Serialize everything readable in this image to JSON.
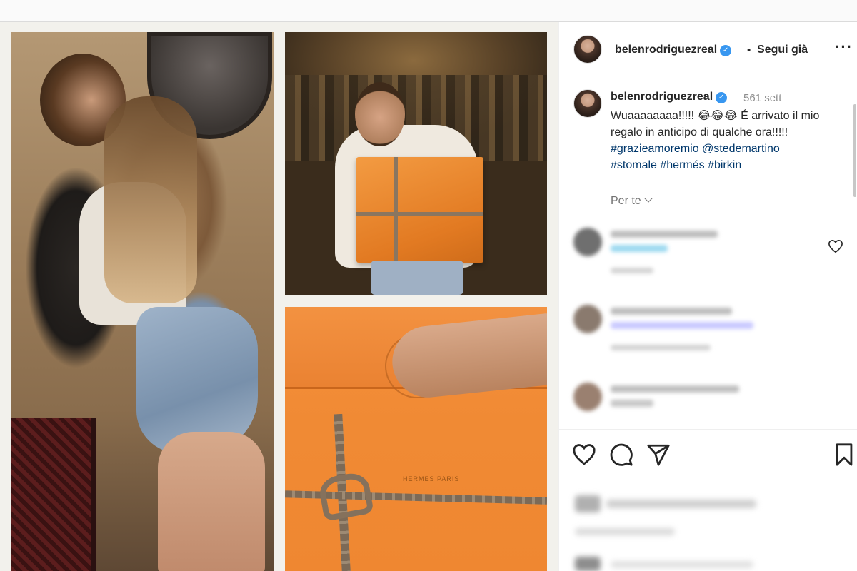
{
  "post": {
    "username": "belenrodriguezreal",
    "verified_mark": "✓",
    "dot": "•",
    "follow_label": "Segui già",
    "more_label": "···",
    "time_ago": "561 sett",
    "caption_text": "Wuaaaaaaaa!!!!! 😂😂😂 É arrivato il mio regalo in anticipo di qualche ora!!!!!",
    "hashtags": [
      "#grazieamoremio",
      "@stedemartino",
      "#stomale",
      "#hermés",
      "#birkin"
    ],
    "filter_label": "Per te",
    "box_brand": "HERMES PARIS"
  },
  "icons": {
    "like": "heart-icon",
    "comment": "comment-icon",
    "share": "share-icon",
    "save": "bookmark-icon",
    "verified": "verified-badge-icon",
    "more": "more-options-icon",
    "chevron": "chevron-down-icon"
  },
  "colors": {
    "verified_blue": "#3897f0",
    "link_blue": "#00376b",
    "secondary_text": "#8e8e8e",
    "box_orange": "#f08a34"
  }
}
